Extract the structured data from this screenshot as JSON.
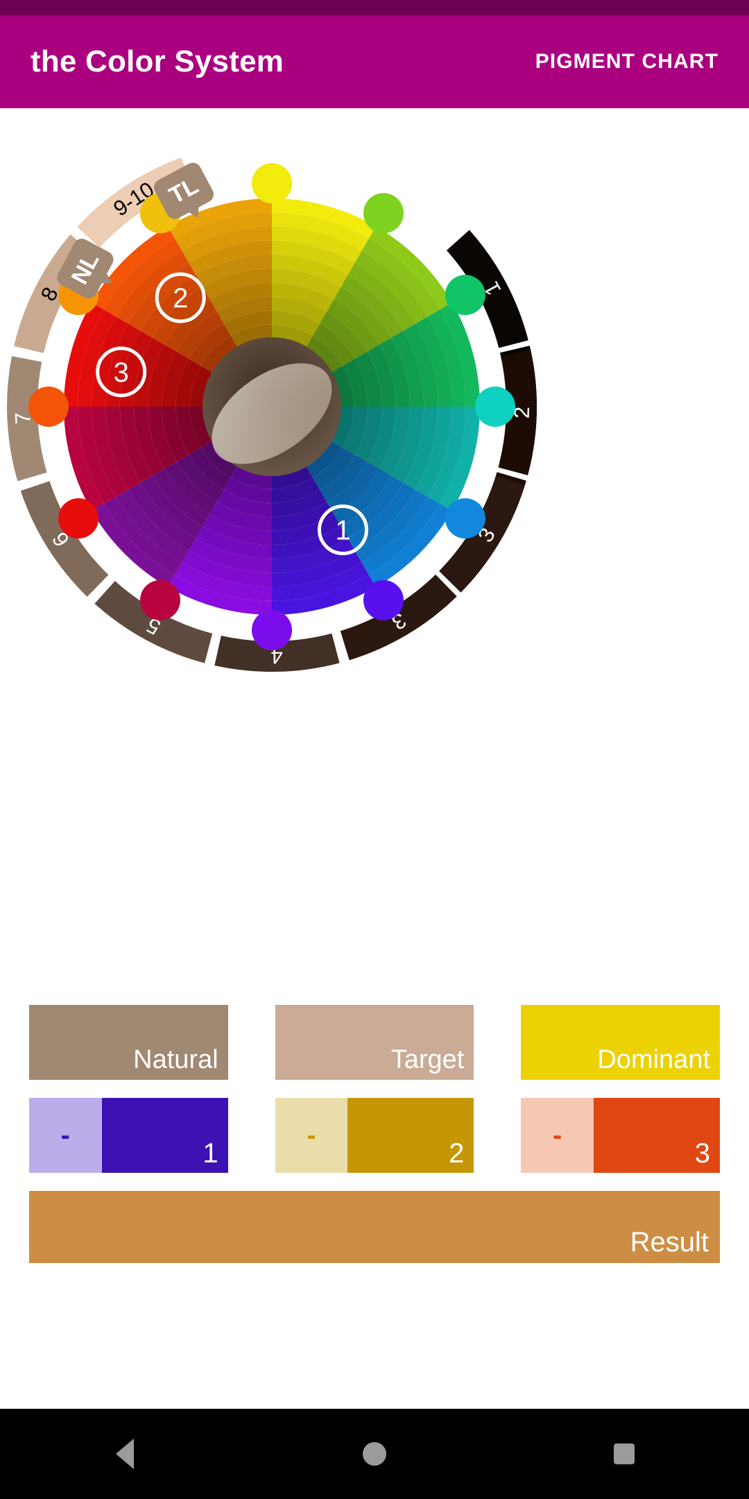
{
  "app": {
    "title": "the Color System",
    "action_label": "PIGMENT CHART",
    "appbar_color": "#aa0080",
    "statusbar_color": "#6d0050"
  },
  "wheel": {
    "chips": [
      {
        "id": "TL",
        "label": "TL",
        "name": "target-level-chip",
        "color": "#a08873"
      },
      {
        "id": "NL",
        "label": "NL",
        "name": "natural-level-chip",
        "color": "#a08873"
      }
    ],
    "level_arc": {
      "segments": [
        {
          "label": "9-10",
          "color": "#edcdb4",
          "text_color": "#000000"
        },
        {
          "label": "8",
          "color": "#c9a98f",
          "text_color": "#000000"
        },
        {
          "label": "7",
          "color": "#a08873",
          "text_color": "#ffffff"
        },
        {
          "label": "6",
          "color": "#806a5a",
          "text_color": "#ffffff"
        },
        {
          "label": "5",
          "color": "#5e4a3e",
          "text_color": "#ffffff"
        },
        {
          "label": "4",
          "color": "#422f26",
          "text_color": "#ffffff"
        },
        {
          "label": "3",
          "color": "#2b1810",
          "text_color": "#ffffff"
        },
        {
          "label": "2",
          "color": "#1d0c06",
          "text_color": "#ffffff"
        },
        {
          "label": "1",
          "color": "#0a0604",
          "text_color": "#ffffff"
        }
      ]
    },
    "pigment_dots": [
      {
        "name": "dot-yellow",
        "color": "#f2eb0c"
      },
      {
        "name": "dot-yellow-green",
        "color": "#7ed321"
      },
      {
        "name": "dot-green",
        "color": "#11c467"
      },
      {
        "name": "dot-teal",
        "color": "#0fd1c1"
      },
      {
        "name": "dot-blue",
        "color": "#1188dd"
      },
      {
        "name": "dot-violet-blue",
        "color": "#5811ee"
      },
      {
        "name": "dot-violet",
        "color": "#7b0ceb"
      },
      {
        "name": "dot-magenta",
        "color": "#b8043f"
      },
      {
        "name": "dot-red",
        "color": "#e80d0d"
      },
      {
        "name": "dot-orange-red",
        "color": "#f45408"
      },
      {
        "name": "dot-orange",
        "color": "#f79406"
      },
      {
        "name": "dot-gold",
        "color": "#efc00c"
      }
    ],
    "selection_markers": [
      {
        "label": "1",
        "name": "marker-1",
        "fill": "#5a12cc"
      },
      {
        "label": "2",
        "name": "marker-2",
        "fill": "#d9a50b"
      },
      {
        "label": "3",
        "name": "marker-3",
        "fill": "#dd4515"
      }
    ],
    "sector_colors": [
      "#f2eb0c",
      "#8fc91a",
      "#14b85c",
      "#11b0a8",
      "#1180d4",
      "#4a14e0",
      "#8b0ce0",
      "#7b1098",
      "#b8043f",
      "#e80d0d",
      "#f45408",
      "#eaa409"
    ],
    "hub_color": "#6b5848"
  },
  "swatches": {
    "top_row": [
      {
        "label": "Natural",
        "color": "#a08873",
        "name": "natural-swatch"
      },
      {
        "label": "Target",
        "color": "#c9ab96",
        "name": "target-swatch"
      },
      {
        "label": "Dominant",
        "color": "#ecd105",
        "name": "dominant-swatch"
      }
    ],
    "pigment_row": [
      {
        "minus": "-",
        "number": "1",
        "light_color": "#bbadea",
        "dark_color": "#3c12b4",
        "name": "pigment-1"
      },
      {
        "minus": "-",
        "number": "2",
        "light_color": "#ebddaa",
        "dark_color": "#c69704",
        "name": "pigment-2"
      },
      {
        "minus": "-",
        "number": "3",
        "light_color": "#f6c8b4",
        "dark_color": "#e04712",
        "name": "pigment-3"
      }
    ],
    "result": {
      "label": "Result",
      "color": "#cd8e44",
      "name": "result-swatch"
    }
  },
  "navbar": {
    "back": "back-icon",
    "home": "home-icon",
    "recents": "recents-icon"
  }
}
